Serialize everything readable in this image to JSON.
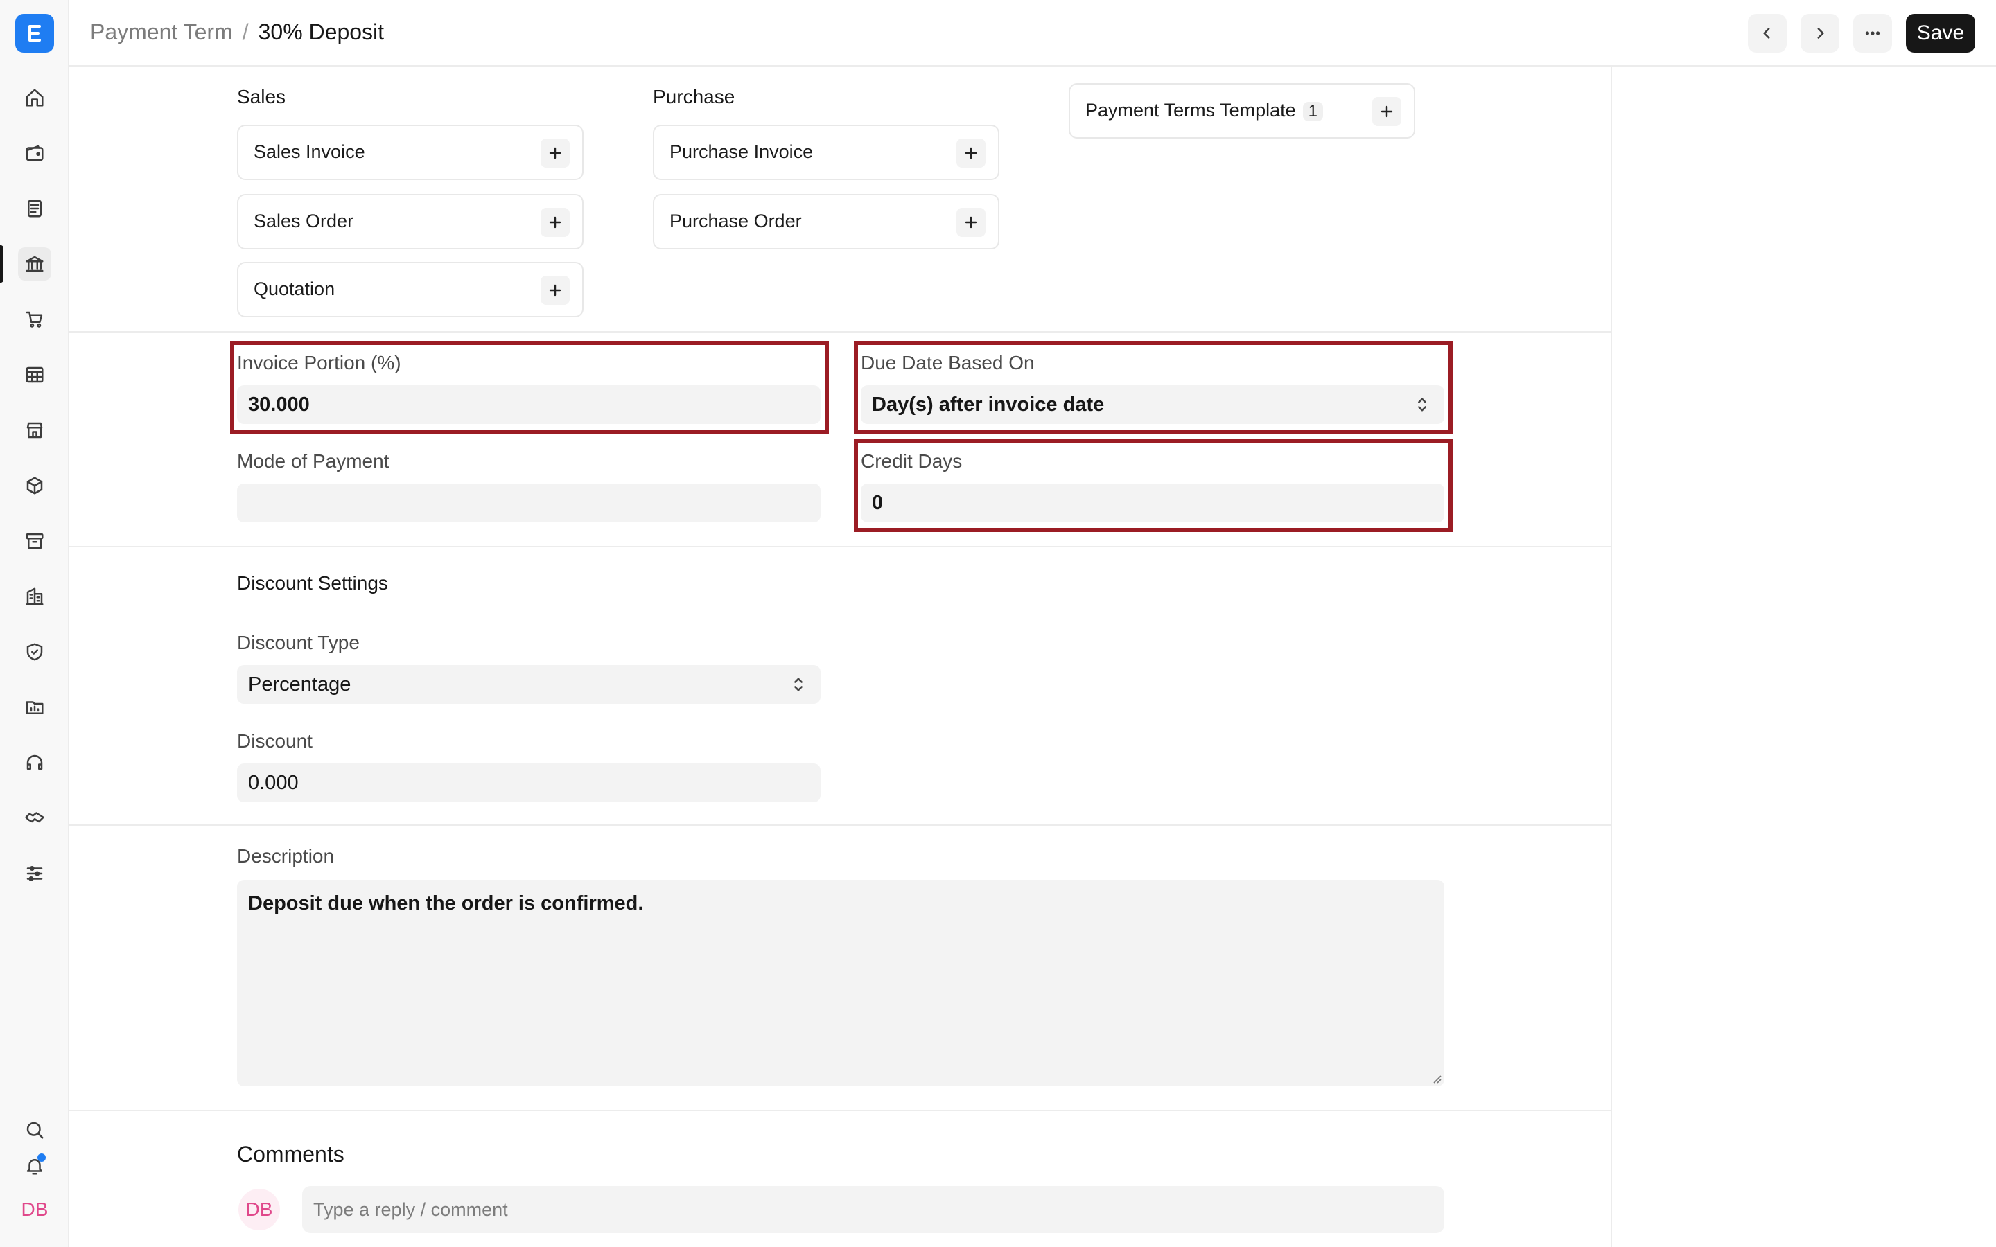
{
  "header": {
    "breadcrumb_parent": "Payment Term",
    "breadcrumb_separator": "/",
    "breadcrumb_current": "30% Deposit",
    "save_label": "Save"
  },
  "sidebar": {
    "avatar_initials": "DB",
    "icons": [
      "home-icon",
      "wallet-icon",
      "file-text-icon",
      "bank-icon",
      "cart-icon",
      "table-icon",
      "store-icon",
      "package-icon",
      "archive-icon",
      "building-icon",
      "shield-icon",
      "folder-chart-icon",
      "headset-icon",
      "handshake-icon",
      "sliders-icon",
      "search-icon",
      "bell-icon"
    ],
    "active_item": "bank-icon",
    "notification_dot_color": "#1f7df2"
  },
  "connections": {
    "sales": {
      "title": "Sales",
      "items": [
        {
          "label": "Sales Invoice"
        },
        {
          "label": "Sales Order"
        },
        {
          "label": "Quotation"
        }
      ]
    },
    "purchase": {
      "title": "Purchase",
      "items": [
        {
          "label": "Purchase Invoice"
        },
        {
          "label": "Purchase Order"
        }
      ]
    },
    "other": {
      "items": [
        {
          "label": "Payment Terms Template",
          "count": "1"
        }
      ]
    }
  },
  "fields": {
    "invoice_portion": {
      "label": "Invoice Portion (%)",
      "value": "30.000"
    },
    "due_date_based_on": {
      "label": "Due Date Based On",
      "value": "Day(s) after invoice date"
    },
    "mode_of_payment": {
      "label": "Mode of Payment",
      "value": ""
    },
    "credit_days": {
      "label": "Credit Days",
      "value": "0"
    }
  },
  "discount": {
    "section_title": "Discount Settings",
    "discount_type": {
      "label": "Discount Type",
      "value": "Percentage"
    },
    "discount": {
      "label": "Discount",
      "value": "0.000"
    }
  },
  "description": {
    "label": "Description",
    "value": "Deposit due when the order is confirmed."
  },
  "comments": {
    "title": "Comments",
    "avatar_initials": "DB",
    "placeholder": "Type a reply / comment"
  },
  "colors": {
    "accent": "#1f7df2",
    "highlight_border": "#9b1c24",
    "save_button": "#171717",
    "avatar_text": "#e0488b"
  }
}
